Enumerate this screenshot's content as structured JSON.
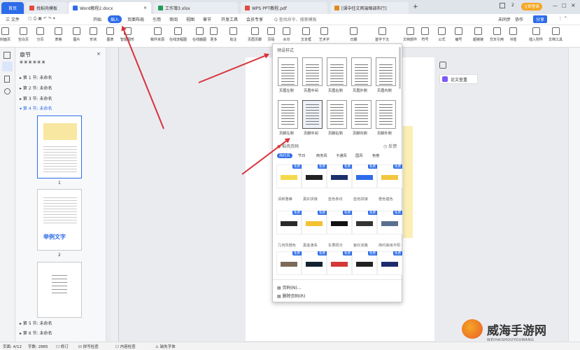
{
  "tabs": [
    {
      "label": "首页",
      "color": "#2d6ce9"
    },
    {
      "label": "找稻壳模板",
      "color": "#e04b3c"
    },
    {
      "label": "Word教程2.docx",
      "color": "#2d6ce9"
    },
    {
      "label": "工作簿3.xlsx",
      "color": "#1f9d55"
    },
    {
      "label": "WPS PPT教程.pdf",
      "color": "#e04b3c"
    },
    {
      "label": "[课中任文两端缩调布行]",
      "color": "#e08a1e"
    }
  ],
  "titlebar": {
    "plus": "+",
    "login": "立即登录",
    "win_count": "2"
  },
  "menu": {
    "file": "三 文件",
    "items": [
      "开始",
      "插入",
      "页面布局",
      "引用",
      "审阅",
      "视图",
      "章节",
      "开发工具",
      "会员专享"
    ],
    "active": "插入",
    "search": "Q 查找命令、搜索模板",
    "unsync": "未同步",
    "collab": "协作",
    "share": "分享"
  },
  "ribbon": [
    "封面页",
    "空白页",
    "分页",
    "表格",
    "图片",
    "形状",
    "图表",
    "智能图形",
    "稿件资源",
    "在线流程图",
    "在线脑图",
    "更多",
    "批注",
    "页眉页脚",
    "页码",
    "水印",
    "文本框",
    "艺术字",
    "日期",
    "首字下沉",
    "文档部件",
    "符号",
    "公式",
    "编号",
    "超链接",
    "交叉引用",
    "书签",
    "插入附件",
    "文档工具",
    "教学工具"
  ],
  "nav": {
    "title": "章节",
    "chapters": [
      "第 1 节: 未命名",
      "第 2 节: 未命名",
      "第 3 节: 未命名",
      "第 4 节: 未命名"
    ],
    "chapters_bottom": [
      "第 5 节: 未命名",
      "第 6 节: 未命名"
    ],
    "thumb_labels": [
      "1",
      "2"
    ],
    "thumb2_text": "举例文字"
  },
  "dropdown": {
    "section_title": "预设样式",
    "preset_labels": [
      "页眉左侧",
      "页眉中间",
      "页眉右侧",
      "页眉外侧",
      "页眉内侧",
      "页脚左侧",
      "页脚中间",
      "页脚右侧",
      "页脚内侧",
      "页脚外侧"
    ],
    "stamp": "稻壳页码",
    "feedback": "反馈",
    "categories": [
      "简约风",
      "节日",
      "商务风",
      "卡通风",
      "国风",
      "色卷"
    ],
    "free": "免费",
    "style_names_row2": [
      "清新雅蒂",
      "黑红拼接",
      "蓝色条纹",
      "蓝色拼接",
      "橙色撞色"
    ],
    "style_names_row3": [
      "几何风橙色",
      "黑金渡系",
      "东果阳光",
      "紫红双路",
      "简约高级平阳"
    ],
    "footer": [
      "页码(N)...",
      "删除页码(R)"
    ]
  },
  "right_panel": {
    "paper_check": "论文查重"
  },
  "status": {
    "page": "页面: 4/12",
    "words": "字数: 2885",
    "spell": "拼写检查",
    "missing": "缺失字体",
    "doc_check": "内容检查",
    "revise": "修订",
    "zoom_pct": "100%"
  },
  "watermark": {
    "cn": "威海手游网",
    "en": "WEIHAISHOUYOUWANG"
  },
  "accent": "#2d6ce9"
}
